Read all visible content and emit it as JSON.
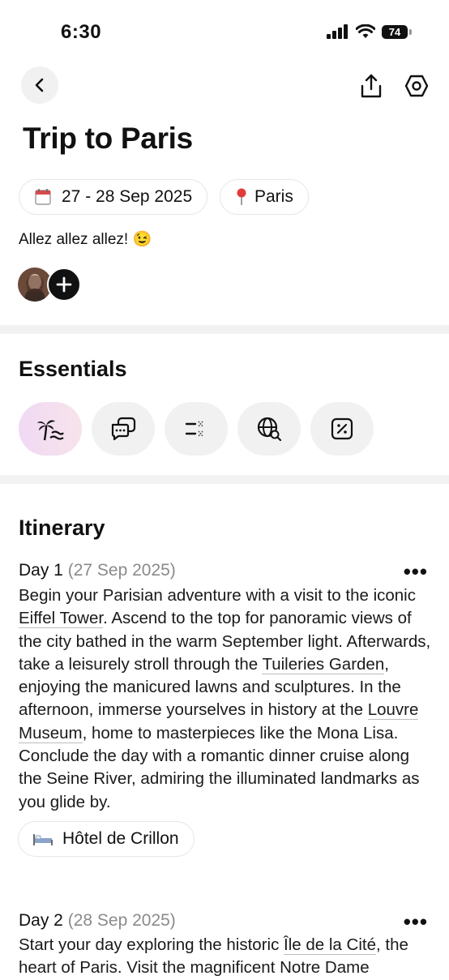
{
  "status_bar": {
    "time": "6:30",
    "battery": "74"
  },
  "header": {
    "title": "Trip to Paris"
  },
  "chips": {
    "dates": "27 - 28 Sep 2025",
    "location": "Paris"
  },
  "description": "Allez allez allez! 😉",
  "essentials": {
    "title": "Essentials",
    "items": [
      {
        "icon": "palm-beach-icon",
        "active": true
      },
      {
        "icon": "chat-bubbles-icon",
        "active": false
      },
      {
        "icon": "checklist-icon",
        "active": false
      },
      {
        "icon": "globe-search-icon",
        "active": false
      },
      {
        "icon": "discount-icon",
        "active": false
      }
    ]
  },
  "itinerary": {
    "title": "Itinerary",
    "days": [
      {
        "label": "Day 1",
        "date": "(27 Sep 2025)",
        "text": {
          "p1": "Begin your Parisian adventure with a visit to the iconic ",
          "l1": "Eiffel Tower",
          "p2": ". Ascend to the top for panoramic views of the city bathed in the warm September light. Afterwards, take a leisurely stroll through the ",
          "l2": "Tuileries Garden",
          "p3": ", enjoying the manicured lawns and sculptures. In the afternoon, immerse yourselves in history at the ",
          "l3": "Louvre Museum",
          "p4": ", home to masterpieces like the Mona Lisa. Conclude the day with a romantic dinner cruise along the Seine River, admiring the illuminated landmarks as you glide by."
        },
        "hotel": "Hôtel de Crillon"
      },
      {
        "label": "Day 2",
        "date": "(28 Sep 2025)",
        "text": {
          "p1": "Start your day exploring the historic ",
          "l1": "Île de la Cité",
          "p2": ", the heart of Paris. Visit the magnificent Notre Dame"
        }
      }
    ]
  },
  "colors": {
    "accent_gradient_start": "#f0d9f5",
    "accent_gradient_end": "#f7e3ea",
    "chip_border": "#e6e6e6"
  }
}
